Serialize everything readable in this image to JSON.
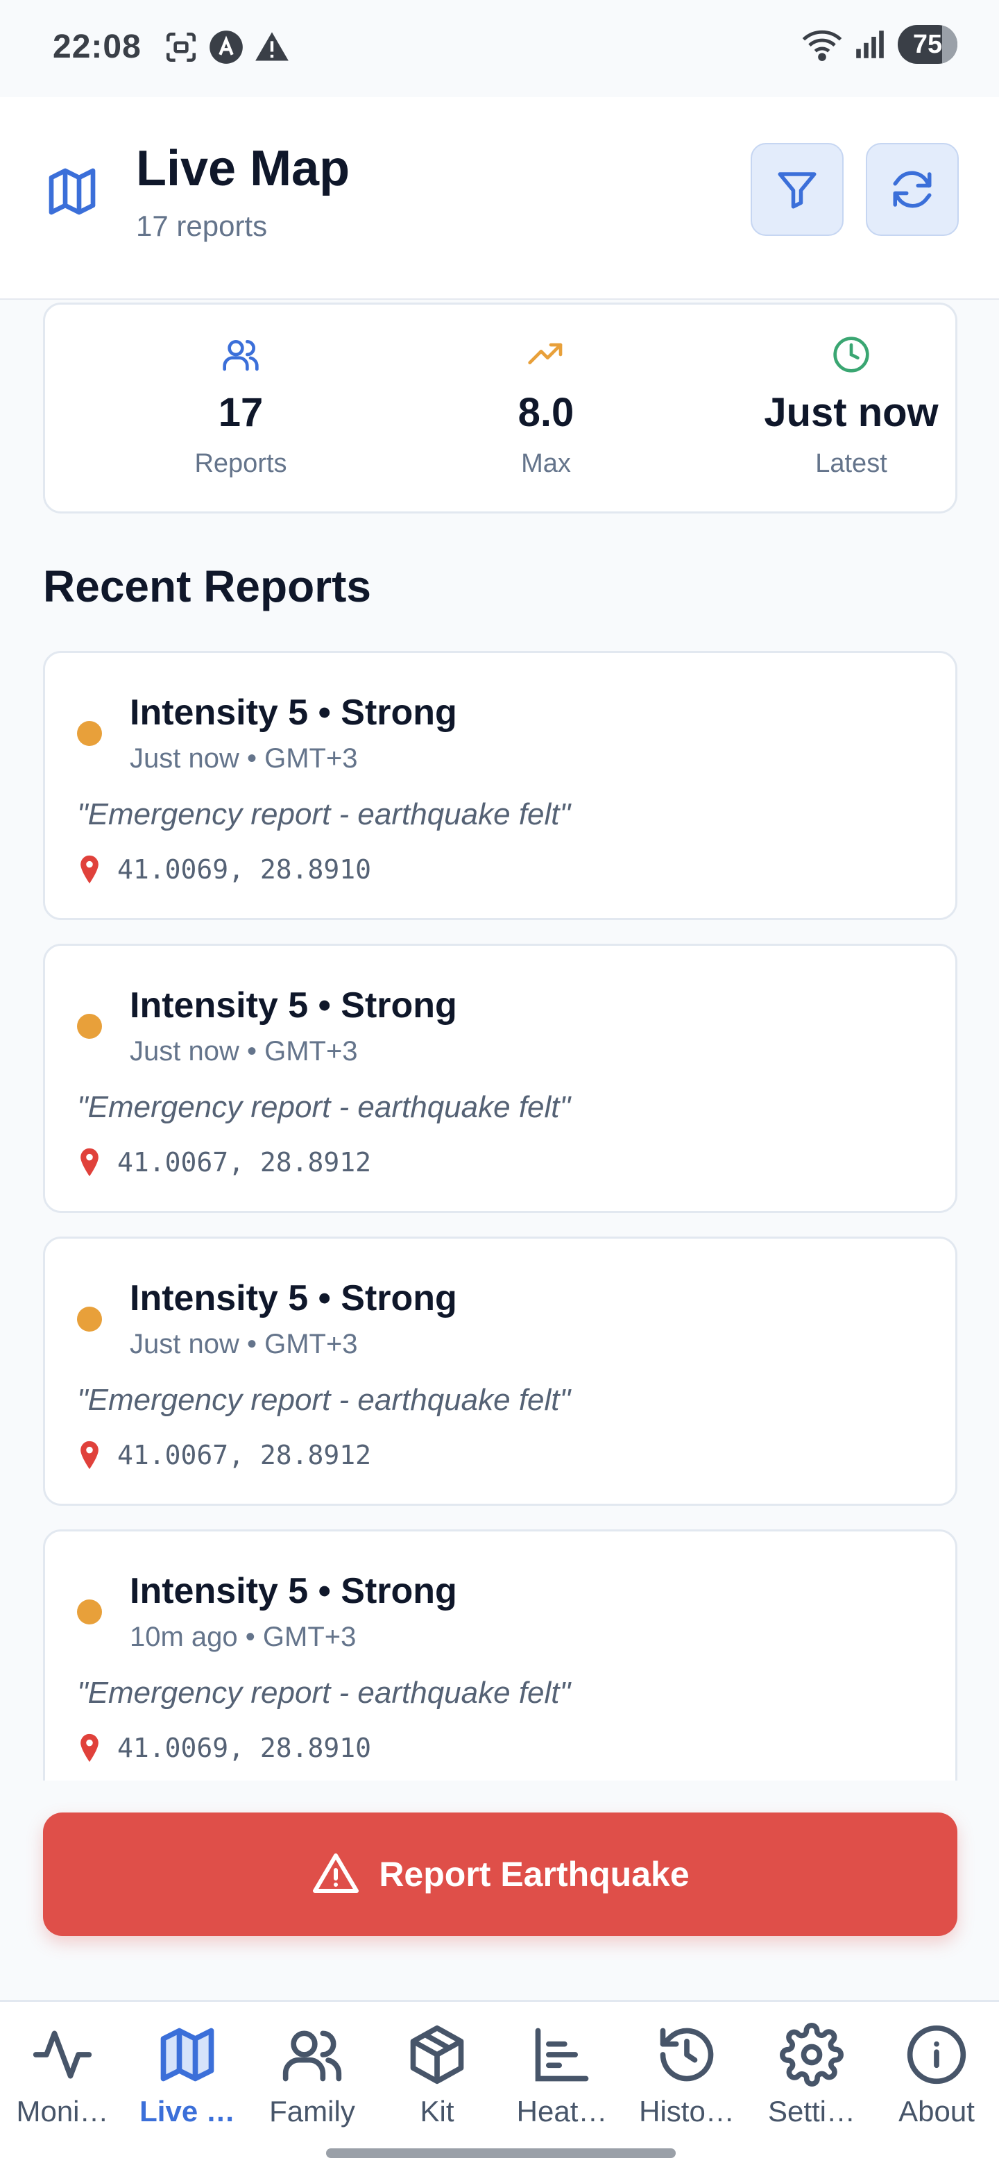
{
  "status_bar": {
    "time": "22:08",
    "battery": "75",
    "icons": [
      "screenshot-icon",
      "app-icon",
      "warning-icon",
      "wifi-icon",
      "signal-icon"
    ]
  },
  "header": {
    "title": "Live Map",
    "subtitle": "17 reports",
    "icon": "map-icon",
    "actions": [
      {
        "name": "filter-button",
        "icon": "filter-icon"
      },
      {
        "name": "refresh-button",
        "icon": "refresh-icon"
      }
    ]
  },
  "stats": [
    {
      "value": "17",
      "label": "Reports",
      "icon": "users-icon",
      "color": "#3b6fd9"
    },
    {
      "value": "8.0",
      "label": "Max",
      "icon": "trending-up-icon",
      "color": "#e8a03a"
    },
    {
      "value": "Just now",
      "label": "Latest",
      "icon": "clock-icon",
      "color": "#3aa672"
    }
  ],
  "section_title": "Recent Reports",
  "reports": [
    {
      "title": "Intensity 5 • Strong",
      "meta": "Just now • GMT+3",
      "quote": "\"Emergency report - earthquake felt\"",
      "coords": "41.0069, 28.8910",
      "dot_color": "#e8a03a"
    },
    {
      "title": "Intensity 5 • Strong",
      "meta": "Just now • GMT+3",
      "quote": "\"Emergency report - earthquake felt\"",
      "coords": "41.0067, 28.8912",
      "dot_color": "#e8a03a"
    },
    {
      "title": "Intensity 5 • Strong",
      "meta": "Just now • GMT+3",
      "quote": "\"Emergency report - earthquake felt\"",
      "coords": "41.0067, 28.8912",
      "dot_color": "#e8a03a"
    },
    {
      "title": "Intensity 5 • Strong",
      "meta": "10m ago • GMT+3",
      "quote": "\"Emergency report - earthquake felt\"",
      "coords": "41.0069, 28.8910",
      "dot_color": "#e8a03a"
    }
  ],
  "cta": {
    "label": "Report Earthquake",
    "icon": "alert-triangle-icon",
    "color": "#df4f49"
  },
  "nav": [
    {
      "label": "Moni…",
      "icon": "activity-icon",
      "active": false
    },
    {
      "label": "Live …",
      "icon": "map-icon",
      "active": true
    },
    {
      "label": "Family",
      "icon": "users-icon",
      "active": false
    },
    {
      "label": "Kit",
      "icon": "package-icon",
      "active": false
    },
    {
      "label": "Heat…",
      "icon": "bar-chart-icon",
      "active": false
    },
    {
      "label": "Histo…",
      "icon": "history-icon",
      "active": false
    },
    {
      "label": "Setti…",
      "icon": "gear-icon",
      "active": false
    },
    {
      "label": "About",
      "icon": "info-icon",
      "active": false
    }
  ],
  "colors": {
    "accent": "#3b6fd9",
    "danger": "#df4f49",
    "warning": "#e8a03a",
    "success": "#3aa672"
  }
}
